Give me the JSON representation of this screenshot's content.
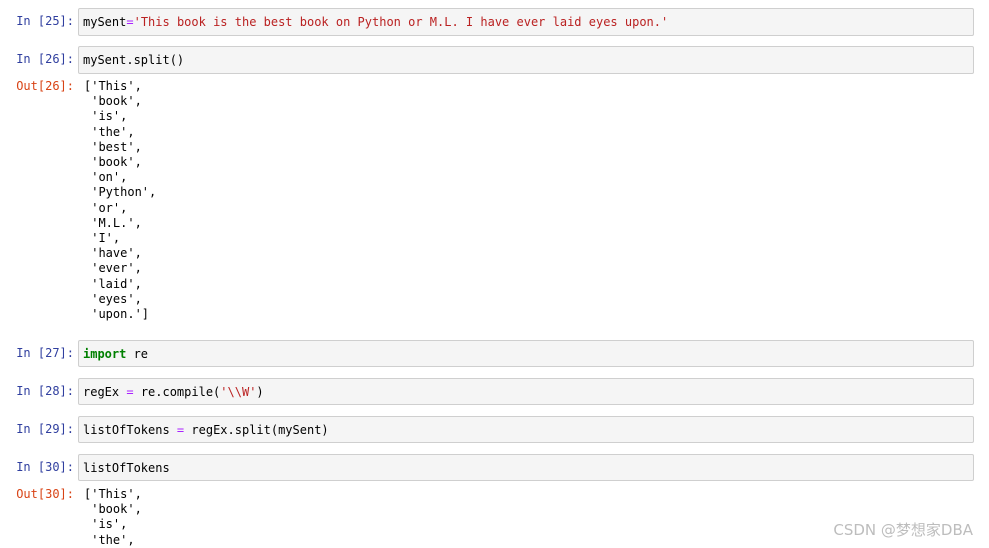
{
  "cells": [
    {
      "prompt": "In [25]:",
      "code": {
        "var": "mySent",
        "eq": "=",
        "str": "'This book is the best book on Python or M.L. I have ever laid eyes upon.'"
      }
    },
    {
      "prompt": "In [26]:",
      "code": "mySent.split()",
      "out_prompt": "Out[26]:",
      "output": [
        "['This',",
        " 'book',",
        " 'is',",
        " 'the',",
        " 'best',",
        " 'book',",
        " 'on',",
        " 'Python',",
        " 'or',",
        " 'M.L.',",
        " 'I',",
        " 'have',",
        " 'ever',",
        " 'laid',",
        " 'eyes',",
        " 'upon.']"
      ]
    },
    {
      "prompt": "In [27]:",
      "code": {
        "kw": "import",
        "rest": " re"
      }
    },
    {
      "prompt": "In [28]:",
      "code": {
        "var": "regEx",
        "eq": " = ",
        "call": "re.compile(",
        "str": "'\\\\W'",
        "close": ")"
      }
    },
    {
      "prompt": "In [29]:",
      "code": {
        "var": "listOfTokens",
        "eq": " = ",
        "rest": "regEx.split(mySent)"
      }
    },
    {
      "prompt": "In [30]:",
      "code": "listOfTokens",
      "out_prompt": "Out[30]:",
      "output": [
        "['This',",
        " 'book',",
        " 'is',",
        " 'the',"
      ]
    }
  ],
  "watermark": "CSDN @梦想家DBA"
}
